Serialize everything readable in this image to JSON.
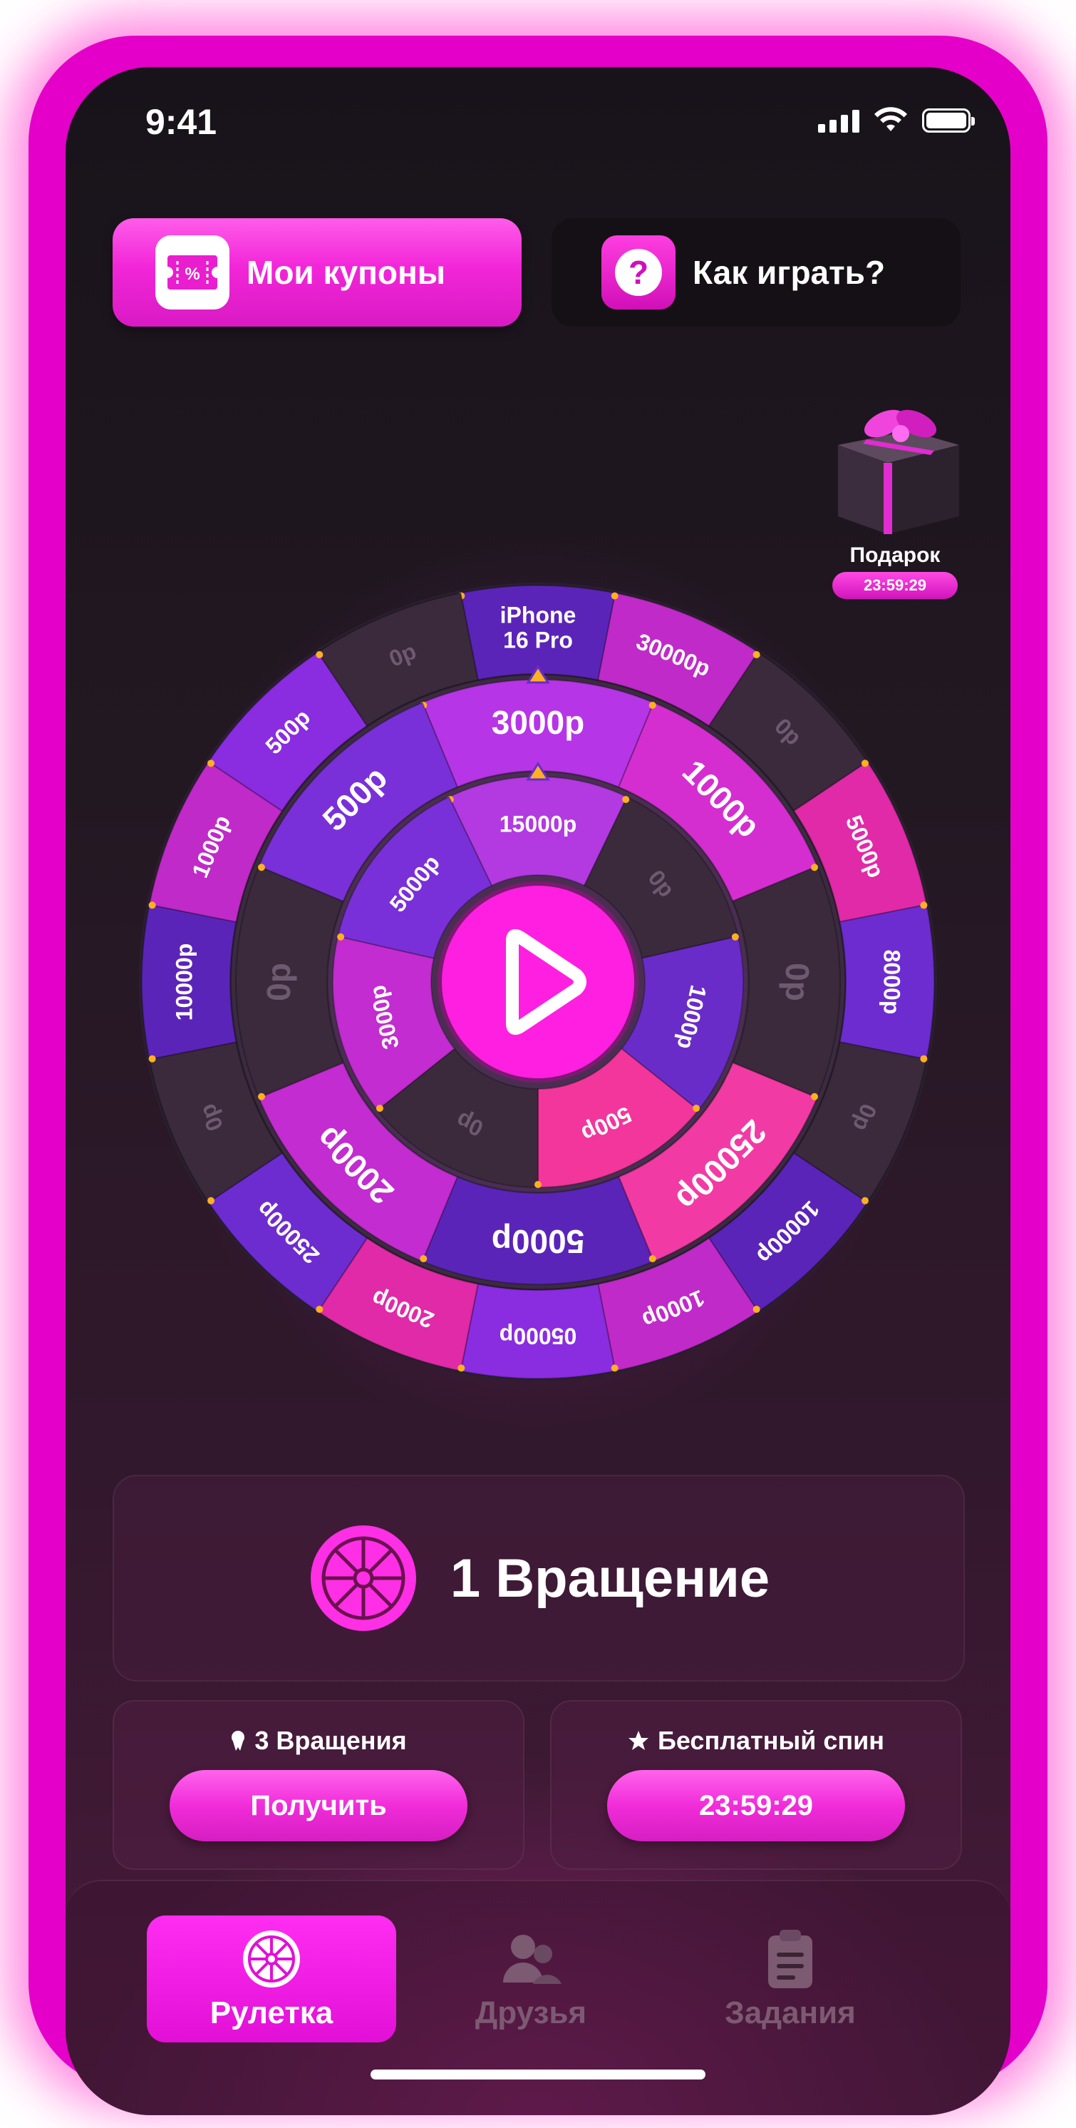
{
  "status": {
    "time": "9:41"
  },
  "header": {
    "coupons_label": "Мои купоны",
    "howto_label": "Как играть?"
  },
  "gift": {
    "label": "Подарок",
    "timer": "23:59:29"
  },
  "wheel": {
    "center_icon": "play-icon",
    "outer": [
      "iPhone 16 Pro",
      "30000р",
      "0р",
      "5000р",
      "8000р",
      "0р",
      "10000р",
      "1000р",
      "05000р",
      "2000р",
      "25000р",
      "0р",
      "10000р",
      "1000р",
      "500р",
      "0р"
    ],
    "middle": [
      "3000р",
      "1000р",
      "0р",
      "25000р",
      "5000р",
      "2000р",
      "0р",
      "500р"
    ],
    "inner": [
      "15000р",
      "0р",
      "1000р",
      "500р",
      "0р",
      "3000р",
      "5000р"
    ]
  },
  "spins": {
    "label": "1 Вращение"
  },
  "cards": {
    "left": {
      "title": "3 Вращения",
      "button": "Получить"
    },
    "right": {
      "title": "Бесплатный спин",
      "button": "23:59:29"
    }
  },
  "tabs": [
    {
      "label": "Рулетка",
      "icon": "wheel-icon"
    },
    {
      "label": "Друзья",
      "icon": "friends-icon"
    },
    {
      "label": "Задания",
      "icon": "clipboard-icon"
    }
  ],
  "colors": {
    "accent": "#f226d8",
    "purple": "#5b24b8",
    "dark": "#2a1f2e"
  }
}
